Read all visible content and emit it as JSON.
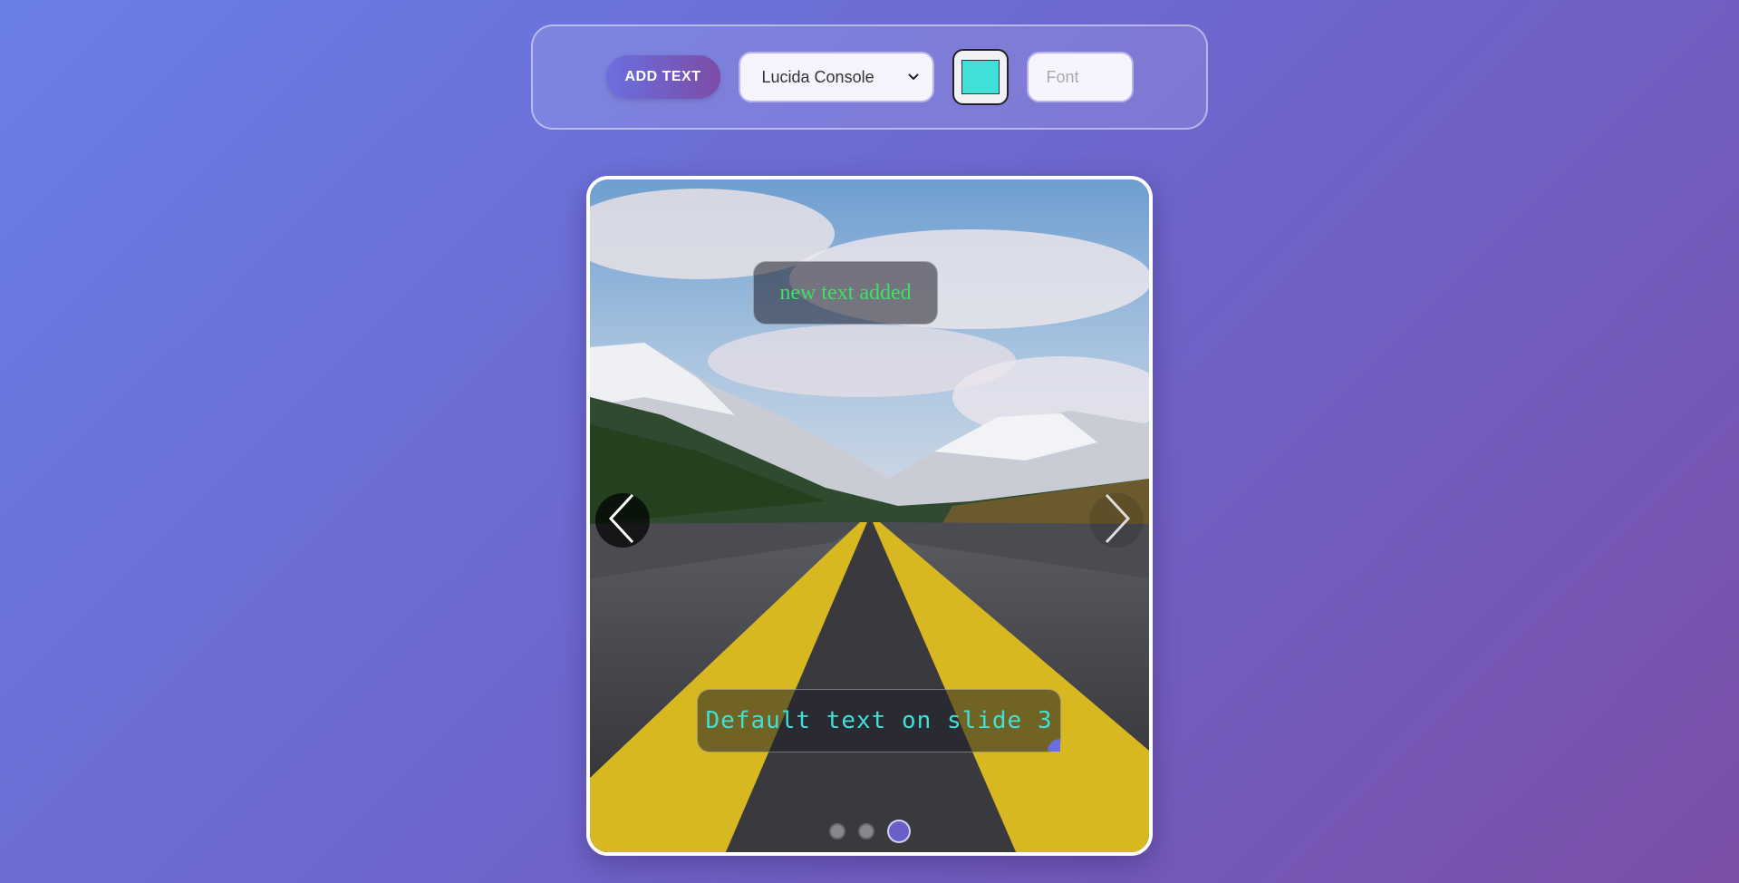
{
  "toolbar": {
    "add_text_label": "ADD TEXT",
    "font_select_value": "Lucida Console",
    "color_value": "#40e0d8",
    "font_size_placeholder": "Font"
  },
  "slider": {
    "slides_total": 3,
    "active_slide": 3,
    "text_overlays": [
      {
        "text": "new text added",
        "color": "#3ee066"
      },
      {
        "text": "Default text on slide 3",
        "color": "#40e0d8"
      }
    ],
    "prev_icon": "chevron-left-icon",
    "next_icon": "chevron-right-icon"
  }
}
